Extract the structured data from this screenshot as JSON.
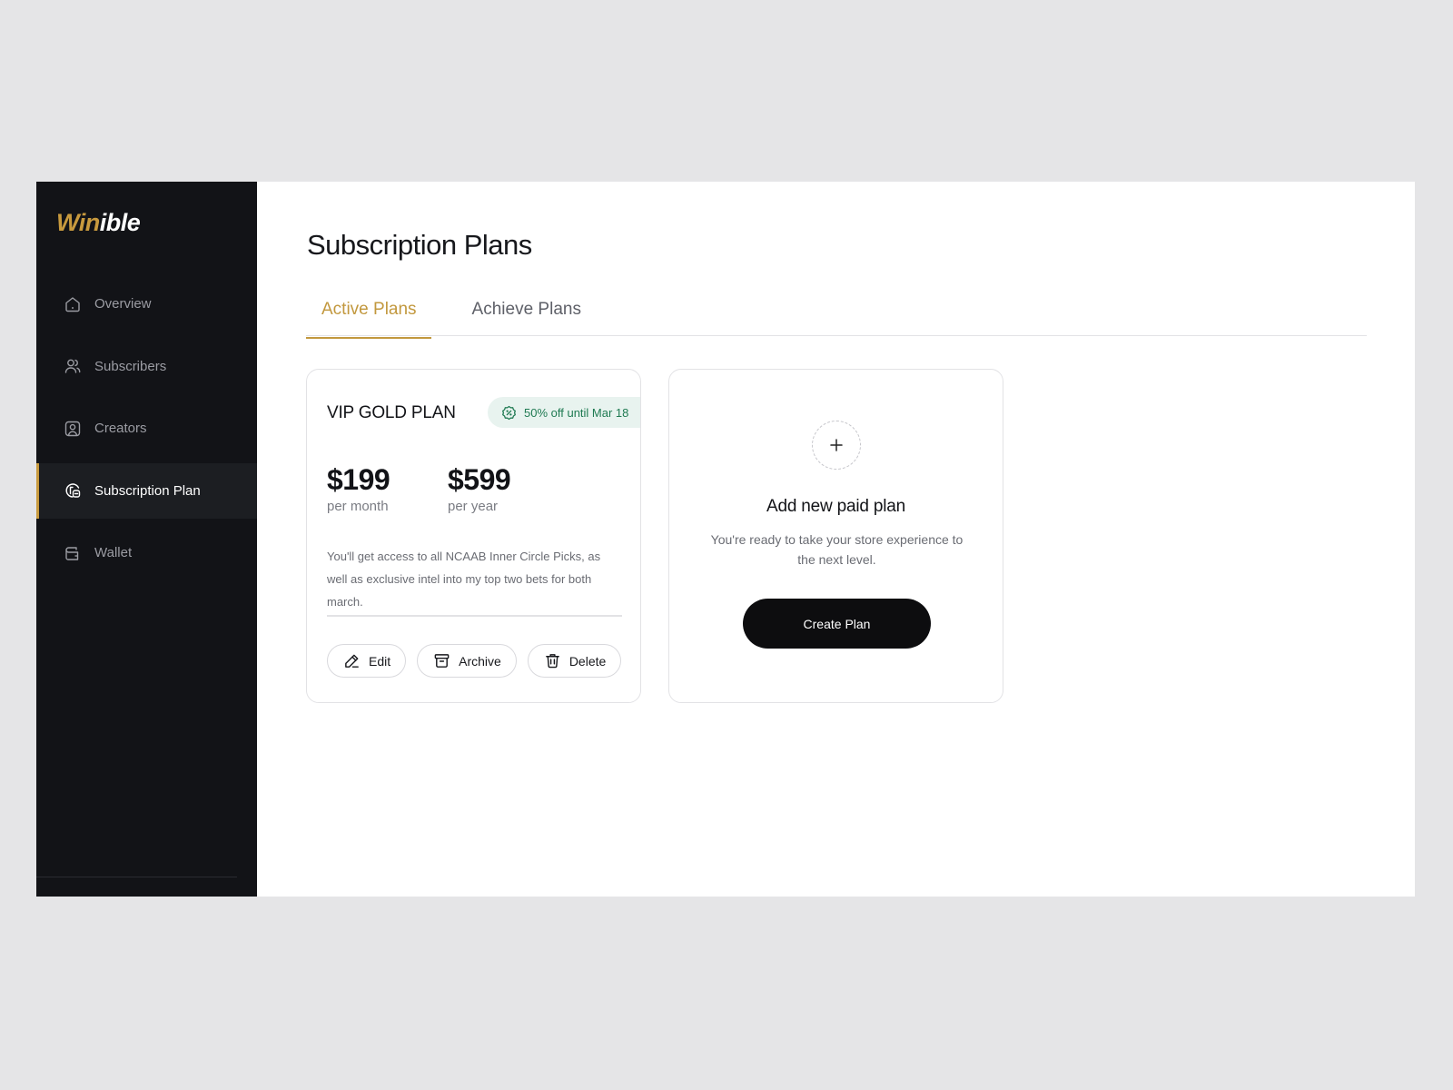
{
  "brand": {
    "name_part1": "Win",
    "name_part2": "ible",
    "accent": "#c89a3e"
  },
  "sidebar": {
    "items": [
      {
        "label": "Overview",
        "icon": "home-icon"
      },
      {
        "label": "Subscribers",
        "icon": "users-icon"
      },
      {
        "label": "Creators",
        "icon": "user-square-icon"
      },
      {
        "label": "Subscription Plan",
        "icon": "coins-icon",
        "active": true
      },
      {
        "label": "Wallet",
        "icon": "wallet-icon"
      }
    ]
  },
  "page": {
    "title": "Subscription Plans"
  },
  "tabs": [
    {
      "label": "Active Plans",
      "active": true
    },
    {
      "label": "Achieve Plans",
      "active": false
    }
  ],
  "plan": {
    "name": "VIP GOLD PLAN",
    "promo": "50% off until Mar 18",
    "monthly_price": "$199",
    "monthly_label": "per month",
    "yearly_price": "$599",
    "yearly_label": "per year",
    "description": "You'll get access to all NCAAB Inner Circle Picks, as well as exclusive intel into my top two bets for both march.",
    "edit_label": "Edit",
    "archive_label": "Archive",
    "delete_label": "Delete"
  },
  "add_plan": {
    "title": "Add new paid plan",
    "description": "You're ready to take your store experience to the next level.",
    "button_label": "Create Plan"
  },
  "colors": {
    "sidebar_bg": "#121317",
    "promo_bg": "#e8f3ef",
    "promo_text": "#1f7a52",
    "primary_button": "#0d0d0f"
  }
}
